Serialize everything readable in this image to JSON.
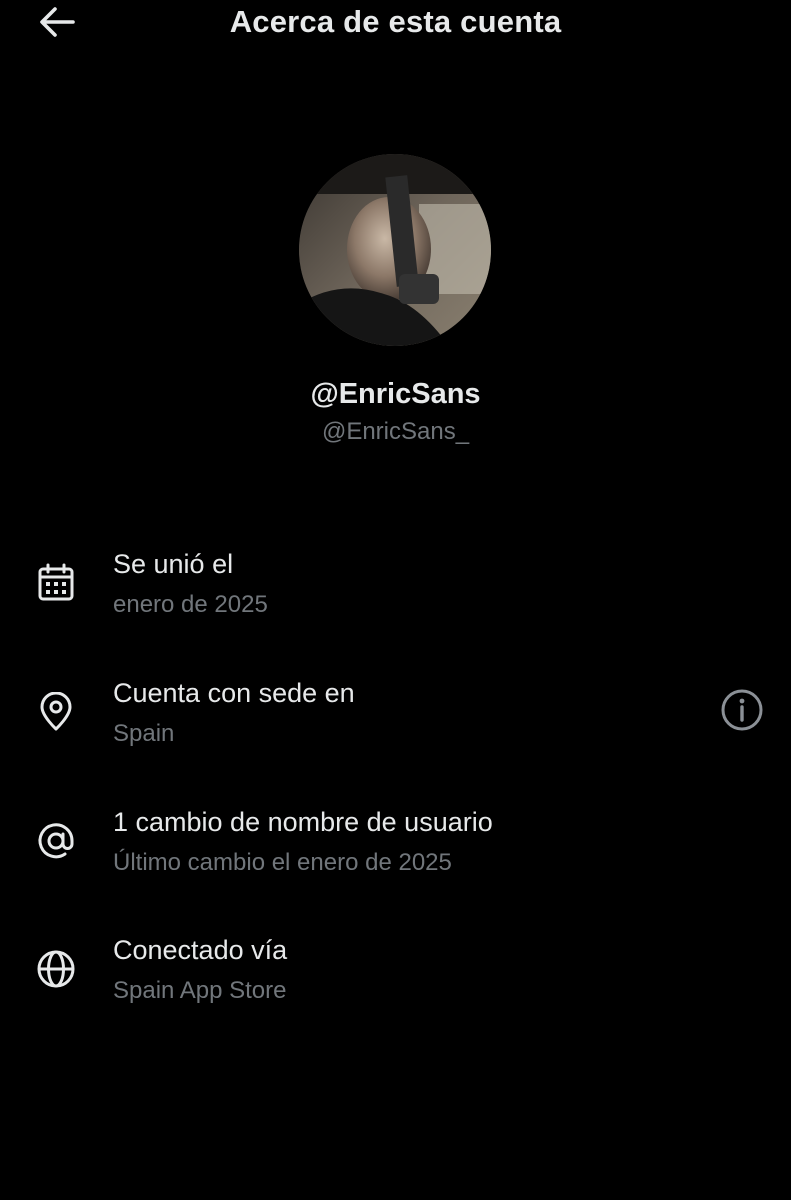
{
  "header": {
    "title": "Acerca de esta cuenta",
    "back_icon": "arrow-left-icon"
  },
  "profile": {
    "display_name": "@EnricSans",
    "handle": "@EnricSans_"
  },
  "details": [
    {
      "icon": "calendar-icon",
      "title": "Se unió el",
      "subtitle": "enero de 2025"
    },
    {
      "icon": "location-pin-icon",
      "title": "Cuenta con sede en",
      "subtitle": "Spain",
      "action_icon": "info-icon"
    },
    {
      "icon": "at-sign-icon",
      "title": "1 cambio de nombre de usuario",
      "subtitle": "Último cambio el enero de 2025"
    },
    {
      "icon": "globe-icon",
      "title": "Conectado vía",
      "subtitle": "Spain App Store"
    }
  ],
  "colors": {
    "background": "#000000",
    "primary_text": "#e7e9ea",
    "secondary_text": "#71767b"
  }
}
